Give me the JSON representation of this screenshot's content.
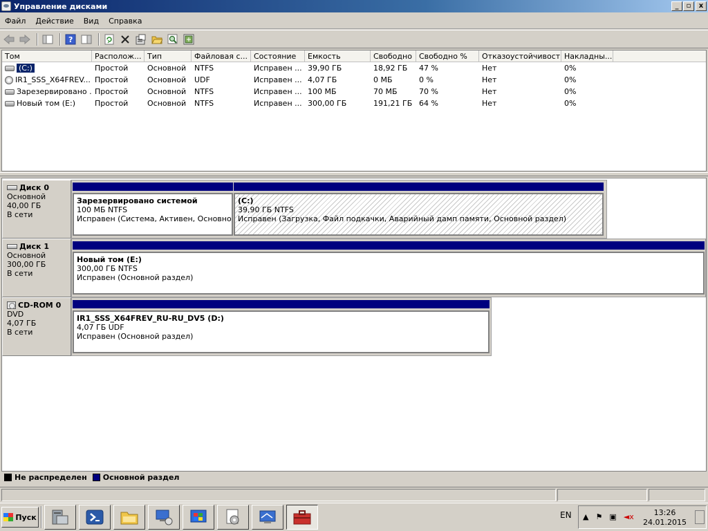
{
  "window": {
    "title": "Управление дисками",
    "min_label": "_",
    "max_label": "▫",
    "close_label": "x"
  },
  "menu": [
    "Файл",
    "Действие",
    "Вид",
    "Справка"
  ],
  "toolbar": {
    "icons": [
      "back-icon",
      "forward-icon",
      "console-tree-icon",
      "help-icon",
      "properties-pane-icon",
      "refresh-icon",
      "delete-icon",
      "properties-icon",
      "open-icon",
      "find-icon",
      "rescan-icon"
    ]
  },
  "volume_list": {
    "columns": [
      "Том",
      "Располож...",
      "Тип",
      "Файловая с...",
      "Состояние",
      "Емкость",
      "Свободно",
      "Свободно %",
      "Отказоустойчивость",
      "Накладны..."
    ],
    "rows": [
      {
        "volume": "(C:)",
        "layout": "Простой",
        "type": "Основной",
        "fs": "NTFS",
        "status": "Исправен ...",
        "capacity": "39,90 ГБ",
        "free": "18,92 ГБ",
        "free_pct": "47 %",
        "fault": "Нет",
        "overhead": "0%"
      },
      {
        "volume": "IR1_SSS_X64FREV...",
        "layout": "Простой",
        "type": "Основной",
        "fs": "UDF",
        "status": "Исправен ...",
        "capacity": "4,07 ГБ",
        "free": "0 МБ",
        "free_pct": "0 %",
        "fault": "Нет",
        "overhead": "0%"
      },
      {
        "volume": "Зарезервировано ...",
        "layout": "Простой",
        "type": "Основной",
        "fs": "NTFS",
        "status": "Исправен ...",
        "capacity": "100 МБ",
        "free": "70 МБ",
        "free_pct": "70 %",
        "fault": "Нет",
        "overhead": "0%"
      },
      {
        "volume": "Новый том (E:)",
        "layout": "Простой",
        "type": "Основной",
        "fs": "NTFS",
        "status": "Исправен ...",
        "capacity": "300,00 ГБ",
        "free": "191,21 ГБ",
        "free_pct": "64 %",
        "fault": "Нет",
        "overhead": "0%"
      }
    ]
  },
  "disks": [
    {
      "name": "Диск 0",
      "kind": "Основной",
      "size": "40,00 ГБ",
      "state": "В сети",
      "partitions": [
        {
          "name": "Зарезервировано системой",
          "size": "100 МБ NTFS",
          "status": "Исправен (Система, Активен, Основной ра"
        },
        {
          "name": "(C:)",
          "size": "39,90 ГБ NTFS",
          "status": "Исправен (Загрузка, Файл подкачки, Аварийный дамп памяти, Основной раздел)"
        }
      ]
    },
    {
      "name": "Диск 1",
      "kind": "Основной",
      "size": "300,00 ГБ",
      "state": "В сети",
      "partitions": [
        {
          "name": "Новый том  (E:)",
          "size": "300,00 ГБ NTFS",
          "status": "Исправен (Основной раздел)"
        }
      ]
    },
    {
      "name": "CD-ROM 0",
      "kind": "DVD",
      "size": "4,07 ГБ",
      "state": "В сети",
      "partitions": [
        {
          "name": "IR1_SSS_X64FREV_RU-RU_DV5  (D:)",
          "size": "4,07 ГБ UDF",
          "status": "Исправен (Основной раздел)"
        }
      ]
    }
  ],
  "legend": {
    "unallocated": "Не распределен",
    "unallocated_color": "#000000",
    "primary": "Основной раздел",
    "primary_color": "#00007f"
  },
  "taskbar": {
    "start_label": "Пуск",
    "apps": [
      "server-manager-icon",
      "powershell-icon",
      "explorer-icon",
      "network-icon",
      "windows-update-icon",
      "settings-icon",
      "remote-desktop-icon",
      "toolbox-icon"
    ],
    "language": "EN",
    "time": "13:26",
    "date": "24.01.2015"
  }
}
